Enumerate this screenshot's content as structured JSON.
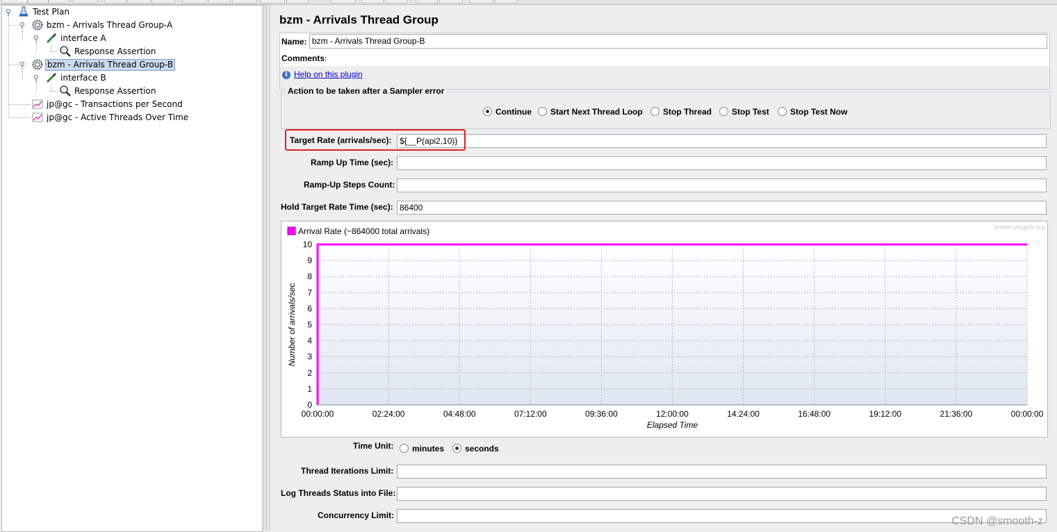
{
  "tree": {
    "items": [
      {
        "label": "Test Plan",
        "icon": "flask-icon"
      },
      {
        "label": "bzm - Arrivals Thread Group-A",
        "icon": "gear-icon"
      },
      {
        "label": "interface A",
        "icon": "pipette-icon"
      },
      {
        "label": "Response Assertion",
        "icon": "magnifier-icon"
      },
      {
        "label": "bzm - Arrivals Thread Group-B",
        "icon": "gear-icon"
      },
      {
        "label": "interface B",
        "icon": "pipette-icon"
      },
      {
        "label": "Response Assertion",
        "icon": "magnifier-icon"
      },
      {
        "label": "jp@gc - Transactions per Second",
        "icon": "graph-icon"
      },
      {
        "label": "jp@gc - Active Threads Over Time",
        "icon": "graph-icon"
      }
    ],
    "selected_index": 4
  },
  "panel": {
    "title": "bzm - Arrivals Thread Group",
    "name_label": "Name:",
    "name_value": "bzm - Arrivals Thread Group-B",
    "comments_label": "Comments:",
    "comments_value": "",
    "help_link": "Help on this plugin",
    "error_action": {
      "legend": "Action to be taken after a Sampler error",
      "options": [
        "Continue",
        "Start Next Thread Loop",
        "Stop Thread",
        "Stop Test",
        "Stop Test Now"
      ],
      "selected": "Continue"
    },
    "fields": {
      "target_rate": {
        "label": "Target Rate (arrivals/sec):",
        "value": "${__P(api2,10)}"
      },
      "ramp_up_time": {
        "label": "Ramp Up Time (sec):",
        "value": ""
      },
      "ramp_up_steps": {
        "label": "Ramp-Up Steps Count:",
        "value": ""
      },
      "hold_time": {
        "label": "Hold Target Rate Time (sec):",
        "value": "86400"
      },
      "iterations_limit": {
        "label": "Thread Iterations Limit:",
        "value": ""
      },
      "log_threads": {
        "label": "Log Threads Status into File:",
        "value": ""
      },
      "concurrency_limit": {
        "label": "Concurrency Limit:",
        "value": ""
      }
    },
    "time_unit": {
      "label": "Time Unit:",
      "options": [
        "minutes",
        "seconds"
      ],
      "selected": "seconds"
    },
    "chart_site": "jmeter-plugins.org"
  },
  "chart_data": {
    "type": "line",
    "legend_entries": [
      "Arrival Rate (~864000 total arrivals)"
    ],
    "xlabel": "Elapsed Time",
    "ylabel": "Number of arrivals/sec",
    "x_ticks": [
      "00:00:00",
      "02:24:00",
      "04:48:00",
      "07:12:00",
      "09:36:00",
      "12:00:00",
      "14:24:00",
      "16:48:00",
      "19:12:00",
      "21:36:00",
      "00:00:00"
    ],
    "y_ticks": [
      0,
      1,
      2,
      3,
      4,
      5,
      6,
      7,
      8,
      9,
      10
    ],
    "ylim": [
      0,
      10
    ],
    "xlim_seconds": [
      0,
      86400
    ],
    "series": [
      {
        "name": "Arrival Rate (~864000 total arrivals)",
        "color": "#ff00ff",
        "x_seconds": [
          0,
          0,
          86400
        ],
        "y": [
          0,
          10,
          10
        ]
      }
    ],
    "grid": true,
    "legend_position": "top-left"
  },
  "watermark": "CSDN @smooth-z",
  "colors": {
    "series": "#ff00ff",
    "highlight": "#e02020",
    "link": "#0000cc",
    "selection": "#c9d9ee"
  }
}
